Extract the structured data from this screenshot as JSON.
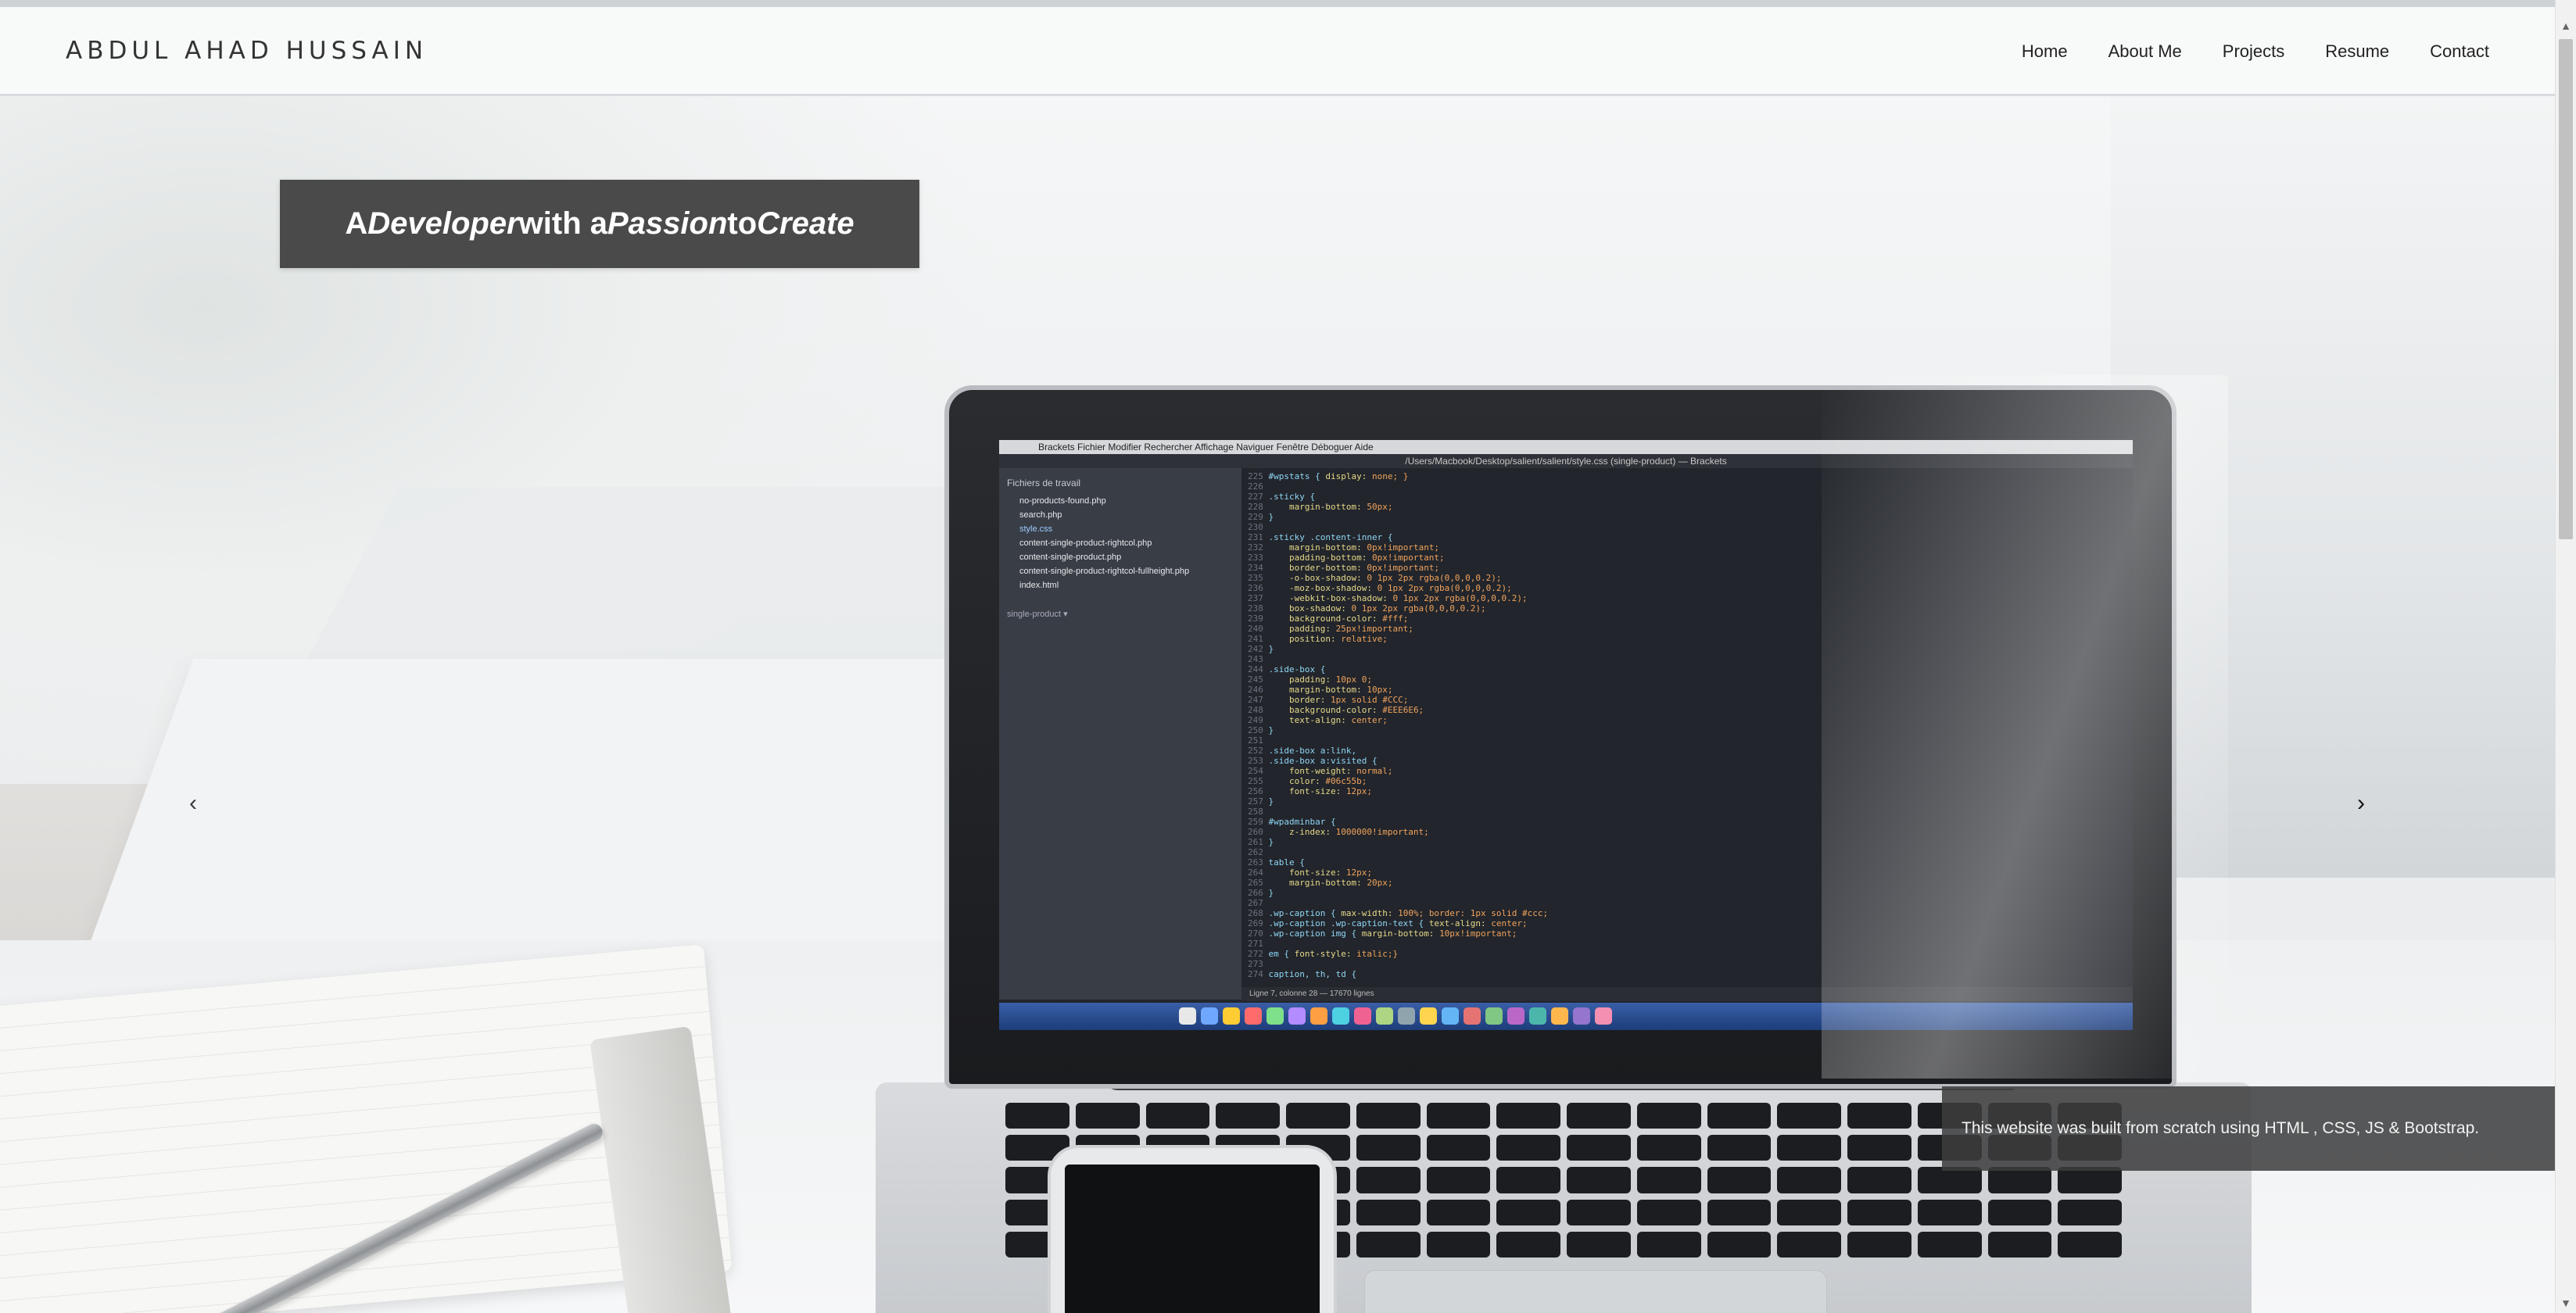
{
  "navbar": {
    "brand": "ABDUL AHAD HUSSAIN",
    "links": [
      "Home",
      "About Me",
      "Projects",
      "Resume",
      "Contact"
    ]
  },
  "hero": {
    "tagline": {
      "a": "A ",
      "developer": "Developer",
      "with_a": " with a ",
      "passion": "Passion",
      "to": " to ",
      "create": "Create"
    },
    "caption": "This website was built from scratch using HTML , CSS, JS & Bootstrap.",
    "arrow_prev": "‹",
    "arrow_next": "›"
  },
  "editor": {
    "menubar": "Brackets   Fichier   Modifier   Rechercher   Affichage   Naviguer   Fenêtre   Déboguer   Aide",
    "title": "/Users/Macbook/Desktop/salient/salient/style.css (single-product) — Brackets",
    "sidebar_header": "Fichiers de travail",
    "files": [
      "no-products-found.php",
      "search.php",
      "style.css",
      "content-single-product-rightcol.php",
      "content-single-product.php",
      "content-single-product-rightcol-fullheight.php",
      "index.html"
    ],
    "workspace": "single-product ▾",
    "status": "Ligne 7, colonne 28 — 17670 lignes"
  },
  "colors": {
    "tagline_bg": "#4a4a4a",
    "caption_bg": "#3c3c3e",
    "navbar_bg": "#f8f9f9"
  }
}
